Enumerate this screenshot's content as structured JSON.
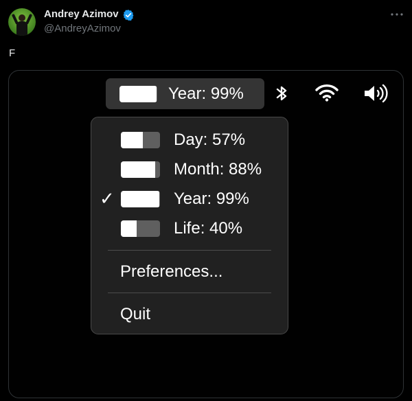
{
  "author": {
    "name": "Andrey Azimov",
    "handle": "@AndreyAzimov",
    "verified": true
  },
  "tweet": {
    "text": "F"
  },
  "icons": {
    "verified": "verified-badge-icon",
    "more": "more-options-icon",
    "bluetooth": "bluetooth-icon",
    "wifi": "wifi-icon",
    "volume": "speaker-volume-icon",
    "check": "checkmark-icon"
  },
  "colors": {
    "accent": "#1d9bf0",
    "background": "#000000",
    "menu_background": "#212121",
    "bar_fill": "#ffffff",
    "bar_track": "#5f5f5f"
  },
  "statusbar": {
    "label": "Year: 99%",
    "progress": 0.99
  },
  "menu": {
    "items": [
      {
        "label": "Day: 57%",
        "progress": 0.57,
        "checked": false
      },
      {
        "label": "Month: 88%",
        "progress": 0.88,
        "checked": false
      },
      {
        "label": "Year: 99%",
        "progress": 0.99,
        "checked": true
      },
      {
        "label": "Life: 40%",
        "progress": 0.4,
        "checked": false
      }
    ],
    "check_glyph": "✓",
    "preferences_label": "Preferences...",
    "quit_label": "Quit"
  }
}
